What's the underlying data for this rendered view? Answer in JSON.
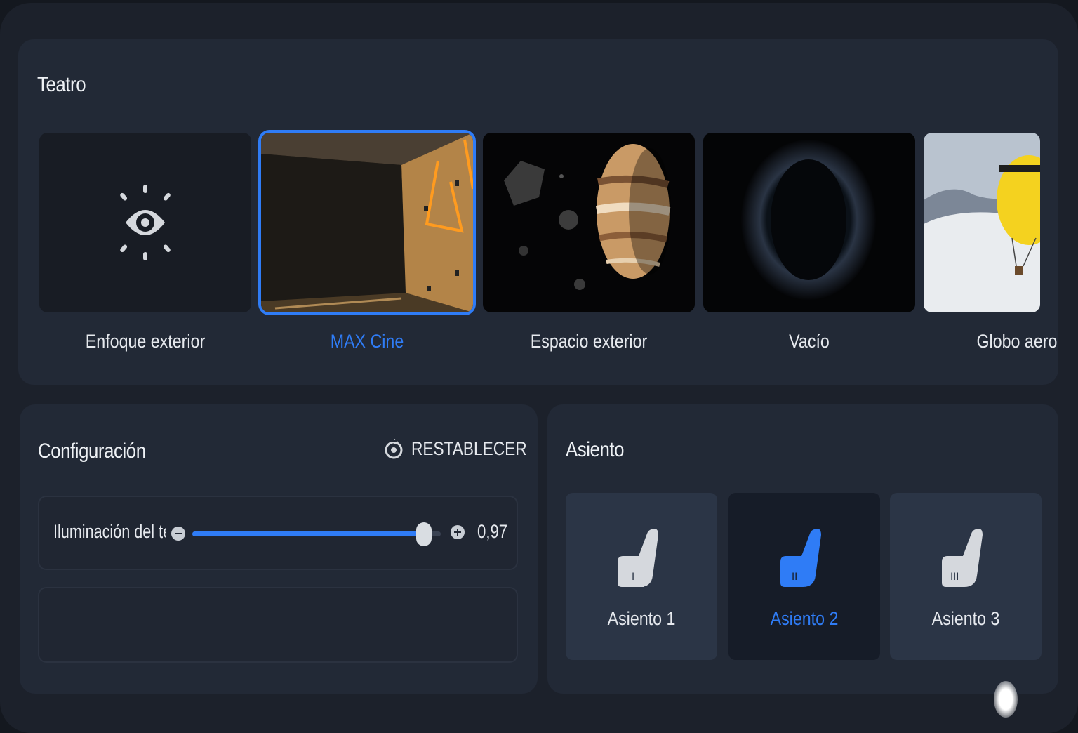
{
  "theater": {
    "title": "Teatro",
    "environments": [
      {
        "label": "Enfoque exterior",
        "selected": false,
        "icon": "eye-icon"
      },
      {
        "label": "MAX Cine",
        "selected": true
      },
      {
        "label": "Espacio exterior",
        "selected": false
      },
      {
        "label": "Vacío",
        "selected": false
      },
      {
        "label": "Globo aero",
        "selected": false
      }
    ]
  },
  "config": {
    "title": "Configuración",
    "reset_label": "RESTABLECER",
    "reset_icon": "reset-icon",
    "lighting": {
      "label": "Iluminación del tea",
      "value": 0.97,
      "value_text": "0,97",
      "minus_icon": "minus-icon",
      "plus_icon": "plus-icon"
    }
  },
  "seat": {
    "title": "Asiento",
    "options": [
      {
        "label": "Asiento 1",
        "numeral": "I",
        "selected": false
      },
      {
        "label": "Asiento 2",
        "numeral": "II",
        "selected": true
      },
      {
        "label": "Asiento 3",
        "numeral": "III",
        "selected": false
      }
    ]
  },
  "colors": {
    "accent": "#2f7cf6",
    "panel": "#222936",
    "background": "#1c212b"
  }
}
